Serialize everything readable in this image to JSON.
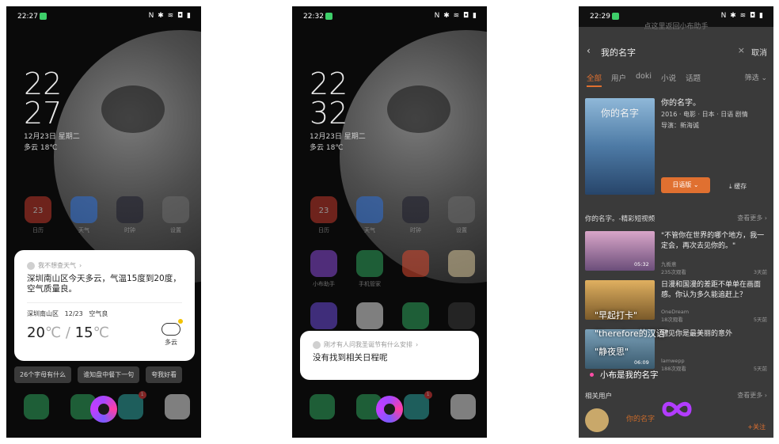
{
  "screen1": {
    "status_time": "22:27",
    "status_icons": "N ✱ ≋ ◘ ▮",
    "clock_hour": "22",
    "clock_min": "27",
    "date_line": "12月23日 星期二",
    "weather_line": "多云 18℃",
    "apps": [
      {
        "label": "日历",
        "icon": "calendar-icon",
        "color": "#c0392b",
        "text": "23"
      },
      {
        "label": "天气",
        "icon": "weather-icon",
        "color": "#2d6fd6",
        "text": ""
      },
      {
        "label": "时钟",
        "icon": "clock-icon",
        "color": "#1b1b2a",
        "text": ""
      },
      {
        "label": "设置",
        "icon": "gear-icon",
        "color": "#6a6a6a",
        "text": ""
      }
    ],
    "card": {
      "hint": "我不想查天气",
      "answer": "深圳南山区今天多云，气温15度到20度，空气质量良。",
      "location": "深圳南山区",
      "date": "12/23",
      "air": "空气良",
      "temp_high": "20",
      "temp_low": "15",
      "unit": "℃",
      "condition": "多云"
    },
    "chips": [
      "26个字母有什么",
      "谁知盘中餐下一句",
      "夸我好看"
    ],
    "dock_badge": "1"
  },
  "screen2": {
    "status_time": "22:32",
    "status_icons": "N ✱ ≋ ◘ ▮",
    "clock_hour": "22",
    "clock_min": "32",
    "date_line": "12月23日 星期二",
    "weather_line": "多云 18℃",
    "apps_row1": [
      {
        "label": "日历",
        "icon": "calendar-icon",
        "color": "#c0392b",
        "text": "23"
      },
      {
        "label": "天气",
        "icon": "weather-icon",
        "color": "#2d6fd6",
        "text": ""
      },
      {
        "label": "时钟",
        "icon": "clock-icon",
        "color": "#1b1b2a",
        "text": ""
      },
      {
        "label": "设置",
        "icon": "gear-icon",
        "color": "#6a6a6a",
        "text": ""
      }
    ],
    "apps_row2": [
      {
        "label": "小布助手",
        "icon": "assistant-icon",
        "color": "#8a4bd6",
        "text": ""
      },
      {
        "label": "手机管家",
        "icon": "shield-icon",
        "color": "#2fa35c",
        "text": ""
      },
      {
        "label": "",
        "icon": "app-red-icon",
        "color": "#d9492f",
        "text": ""
      },
      {
        "label": "",
        "icon": "notes-icon",
        "color": "#d8c69a",
        "text": ""
      }
    ],
    "apps_row3": [
      {
        "label": "",
        "icon": "theme-icon",
        "color": "#6b4bd6",
        "text": ""
      },
      {
        "label": "",
        "icon": "photos-icon",
        "color": "#e0e0e0",
        "text": ""
      },
      {
        "label": "",
        "icon": "store-icon",
        "color": "#2fa35c",
        "text": ""
      },
      {
        "label": "",
        "icon": "folder-icon",
        "color": "#3a3a3a",
        "text": ""
      }
    ],
    "card": {
      "hint": "刚才有人问我圣诞节有什么安排",
      "answer": "没有找到相关日程呢"
    },
    "dock_badge": "1"
  },
  "screen3": {
    "status_time": "22:29",
    "status_icons": "N ✱ ≋ ◘ ▮",
    "banner": "点这里返回小布助手",
    "query": "我的名字",
    "cancel": "取消",
    "tabs": [
      "全部",
      "用户",
      "doki",
      "小说",
      "话题"
    ],
    "filter": "筛选",
    "movie": {
      "poster_title": "你的名字",
      "title": "你的名字。",
      "meta": "2016 · 电影 · 日本 · 日语 剧情",
      "director": "导演：新海诚",
      "watch_button": "日语版",
      "cache": "缓存"
    },
    "section1_title": "你的名字。-精彩短视频",
    "section1_more": "查看更多",
    "videos": [
      {
        "title": "\"不管你在世界的哪个地方，我一定会，再次去见你的。\"",
        "author": "九栀意",
        "views": "235次观看",
        "age": "3天前",
        "duration": "05:32"
      },
      {
        "title": "日漫和国漫的差距不单单在画面感。你认为多久能追赶上？",
        "author": "OneDream",
        "views": "18次观看",
        "age": "5天前",
        "duration": ""
      },
      {
        "title": "遇见你是最美丽的意外",
        "author": "lamwepp",
        "views": "188次观看",
        "age": "5天前",
        "duration": "06:09"
      }
    ],
    "overlay_lines": [
      "\"早起打卡\"",
      "\"therefore的汉语\"",
      "\"静夜思\""
    ],
    "listening_text": "小布是我的名字",
    "section2_title": "相关用户",
    "section2_more": "查看更多",
    "user_row": "你的名字",
    "follow": "+关注"
  }
}
